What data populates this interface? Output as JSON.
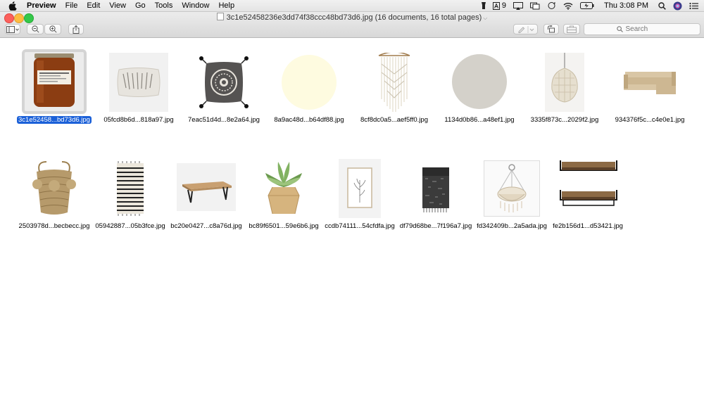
{
  "menubar": {
    "app_name": "Preview",
    "items": [
      "File",
      "Edit",
      "View",
      "Go",
      "Tools",
      "Window",
      "Help"
    ],
    "status": {
      "badge_count": "9",
      "clock": "Thu 3:08 PM"
    }
  },
  "window": {
    "title": "3c1e52458236e3dd74f38ccc48bd73d6.jpg (16 documents, 16 total pages)",
    "search_placeholder": "Search"
  },
  "thumbnails": [
    {
      "label": "3c1e52458...bd73d6.jpg",
      "subject": "amber jar candle",
      "selected": true
    },
    {
      "label": "05fcd8b6d...818a97.jpg",
      "subject": "lumbar pillow"
    },
    {
      "label": "7eac51d4d...8e2a64.jpg",
      "subject": "tasseled medallion pillow"
    },
    {
      "label": "8a9ac48d...b64df88.jpg",
      "subject": "pale yellow swatch",
      "color": "#fefbe0"
    },
    {
      "label": "8cf8dc0a5...aef5ff0.jpg",
      "subject": "macrame wall hanging"
    },
    {
      "label": "1134d0b86...a48ef1.jpg",
      "subject": "gray swatch",
      "color": "#d4d1ca"
    },
    {
      "label": "3335f873c...2029f2.jpg",
      "subject": "woven pendant lamp"
    },
    {
      "label": "934376f5c...c4e0e1.jpg",
      "subject": "beige sectional sofa"
    },
    {
      "label": "2503978d...becbecc.jpg",
      "subject": "woven pom-pom basket"
    },
    {
      "label": "05942887...05b3fce.jpg",
      "subject": "striped rug"
    },
    {
      "label": "bc20e0427...c8a76d.jpg",
      "subject": "wood coffee table"
    },
    {
      "label": "bc89f6501...59e6b6.jpg",
      "subject": "succulent in wood pot"
    },
    {
      "label": "ccdb74111...54cfdfa.jpg",
      "subject": "framed botanical print"
    },
    {
      "label": "df79d68be...7f196a7.jpg",
      "subject": "black throw blanket"
    },
    {
      "label": "fd342409b...2a5ada.jpg",
      "subject": "macrame hanging chair"
    },
    {
      "label": "fe2b156d1...d53421.jpg",
      "subject": "wall shelves"
    }
  ]
}
